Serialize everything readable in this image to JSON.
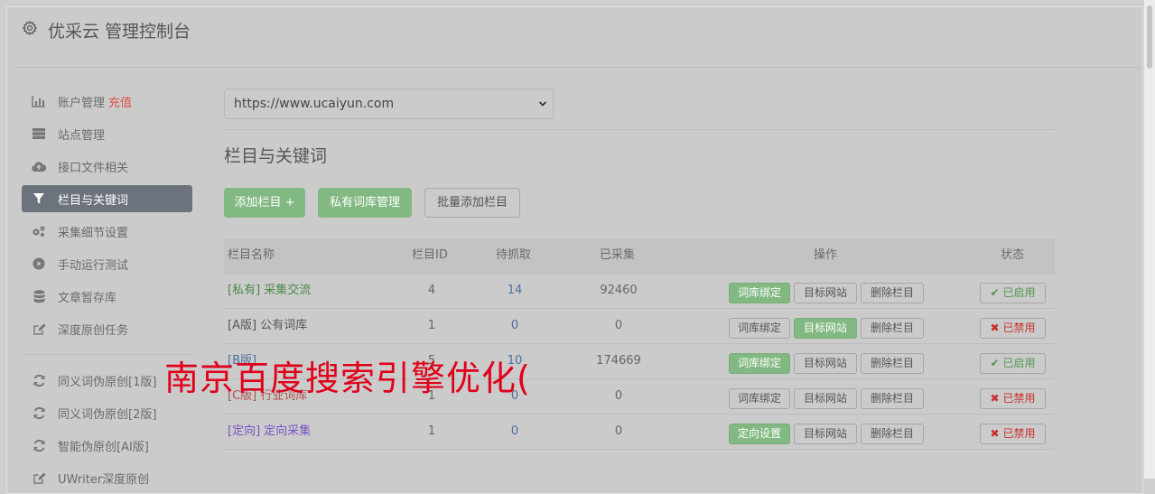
{
  "header": {
    "title": "优采云 管理控制台",
    "icon": "gear-icon"
  },
  "sidebar": {
    "items": [
      {
        "label": "账户管理",
        "badge": "充值",
        "icon": "bar-chart-icon"
      },
      {
        "label": "站点管理",
        "icon": "server-icon"
      },
      {
        "label": "接口文件相关",
        "icon": "cloud-upload-icon"
      },
      {
        "label": "栏目与关键词",
        "icon": "filter-icon",
        "active": true
      },
      {
        "label": "采集细节设置",
        "icon": "gears-icon"
      },
      {
        "label": "手动运行测试",
        "icon": "play-circle-icon"
      },
      {
        "label": "文章暂存库",
        "icon": "database-icon"
      },
      {
        "label": "深度原创任务",
        "icon": "edit-icon"
      },
      {
        "label": "同义词伪原创[1版]",
        "icon": "refresh-icon"
      },
      {
        "label": "同义词伪原创[2版]",
        "icon": "refresh-icon"
      },
      {
        "label": "智能伪原创[AI版]",
        "icon": "refresh-icon"
      },
      {
        "label": "UWriter深度原创",
        "icon": "edit-icon"
      }
    ]
  },
  "main": {
    "site_select": {
      "value": "https://www.ucaiyun.com"
    },
    "section_title": "栏目与关键词",
    "buttons": {
      "add_column": "添加栏目 +",
      "private_lexicon": "私有词库管理",
      "batch_add": "批量添加栏目"
    },
    "table": {
      "headers": {
        "name": "栏目名称",
        "id": "栏目ID",
        "pending": "待抓取",
        "collected": "已采集",
        "actions": "操作",
        "status": "状态"
      },
      "rows": [
        {
          "tag": "[私有]",
          "name": "采集交流",
          "id": "4",
          "pending": "14",
          "collected": "92460",
          "action1": "词库绑定",
          "action2": "目标网站",
          "action3": "删除栏目",
          "status": "已启用"
        },
        {
          "tag": "[A版]",
          "name": "公有词库",
          "id": "1",
          "pending": "0",
          "collected": "0",
          "action1": "词库绑定",
          "action2": "目标网站",
          "action3": "删除栏目",
          "status": "已禁用"
        },
        {
          "tag": "[B版]",
          "name": "",
          "id": "5",
          "pending": "10",
          "collected": "174669",
          "action1": "词库绑定",
          "action2": "目标网站",
          "action3": "删除栏目",
          "status": "已启用"
        },
        {
          "tag": "[C版]",
          "name": "行业词库",
          "id": "1",
          "pending": "0",
          "collected": "0",
          "action1": "词库绑定",
          "action2": "目标网站",
          "action3": "删除栏目",
          "status": "已禁用"
        },
        {
          "tag": "[定向]",
          "name": "定向采集",
          "id": "1",
          "pending": "0",
          "collected": "0",
          "action1": "定向设置",
          "action2": "目标网站",
          "action3": "删除栏目",
          "status": "已禁用"
        }
      ]
    }
  },
  "overlay": {
    "text": "南京百度搜索引擎优化("
  },
  "colors": {
    "green": "#82b882",
    "active_nav": "#6d737c",
    "danger": "#d9534f",
    "overlay": "#e0001a"
  }
}
